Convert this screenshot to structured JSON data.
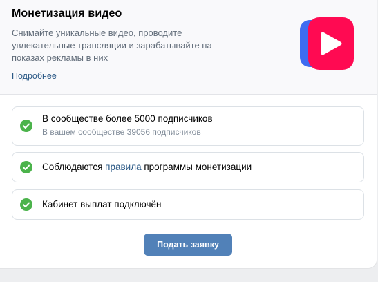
{
  "header": {
    "title": "Монетизация видео",
    "description": "Снимайте уникальные видео, проводите увлекательные трансляции и зарабатывайте на показах рекламы в них",
    "more_link": "Подробнее",
    "logo_icon": "vk-video-logo-icon",
    "logo_colors": {
      "back": "#3f6cf1",
      "front": "#ff0a52"
    }
  },
  "requirements": [
    {
      "text": "В сообществе более 5000 подписчиков",
      "subtext": "В вашем сообществе 39056 подписчиков",
      "status": "done",
      "icon": "check-circle-icon"
    },
    {
      "text_before": "Соблюдаются ",
      "link": "правила",
      "text_after": " программы монетизации",
      "status": "done",
      "icon": "check-circle-icon"
    },
    {
      "text": "Кабинет выплат подключён",
      "status": "done",
      "icon": "check-circle-icon"
    }
  ],
  "apply_button": "Подать заявку",
  "colors": {
    "accent": "#5181b8",
    "link": "#2a5885",
    "success": "#4bb34b"
  }
}
